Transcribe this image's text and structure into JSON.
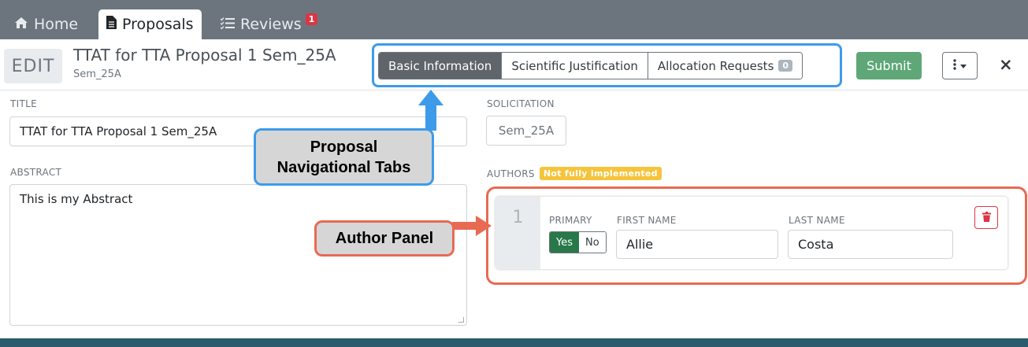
{
  "nav": {
    "tabs": [
      {
        "label": "Home",
        "icon": "home-icon"
      },
      {
        "label": "Proposals",
        "icon": "file-icon"
      },
      {
        "label": "Reviews",
        "icon": "list-icon",
        "badge": "1"
      }
    ]
  },
  "header": {
    "mode": "EDIT",
    "title": "TTAT for TTA Proposal 1 Sem_25A",
    "subtitle": "Sem_25A",
    "tabs": [
      "Basic Information",
      "Scientific Justification",
      "Allocation Requests"
    ],
    "allocation_count": "0",
    "submit_label": "Submit",
    "close_label": "×"
  },
  "form": {
    "title_label": "TITLE",
    "title_value": "TTAT for TTA Proposal 1 Sem_25A",
    "abstract_label": "ABSTRACT",
    "abstract_value": "This is my Abstract",
    "solicitation_label": "SOLICITATION",
    "solicitation_value": "Sem_25A",
    "authors_label": "AUTHORS",
    "authors_badge": "Not fully implemented"
  },
  "author": {
    "index": "1",
    "primary_label": "PRIMARY",
    "yes_label": "Yes",
    "no_label": "No",
    "first_name_label": "FIRST NAME",
    "first_name_value": "Allie",
    "last_name_label": "LAST NAME",
    "last_name_value": "Costa"
  },
  "annotations": {
    "tabs_callout_line1": "Proposal",
    "tabs_callout_line2": "Navigational Tabs",
    "author_callout": "Author Panel"
  },
  "colors": {
    "nav_bg": "#6c757d",
    "accent_blue": "#3d9be9",
    "accent_red": "#e86a52",
    "submit_green": "#5fa777",
    "footer": "#2b5c6d"
  }
}
